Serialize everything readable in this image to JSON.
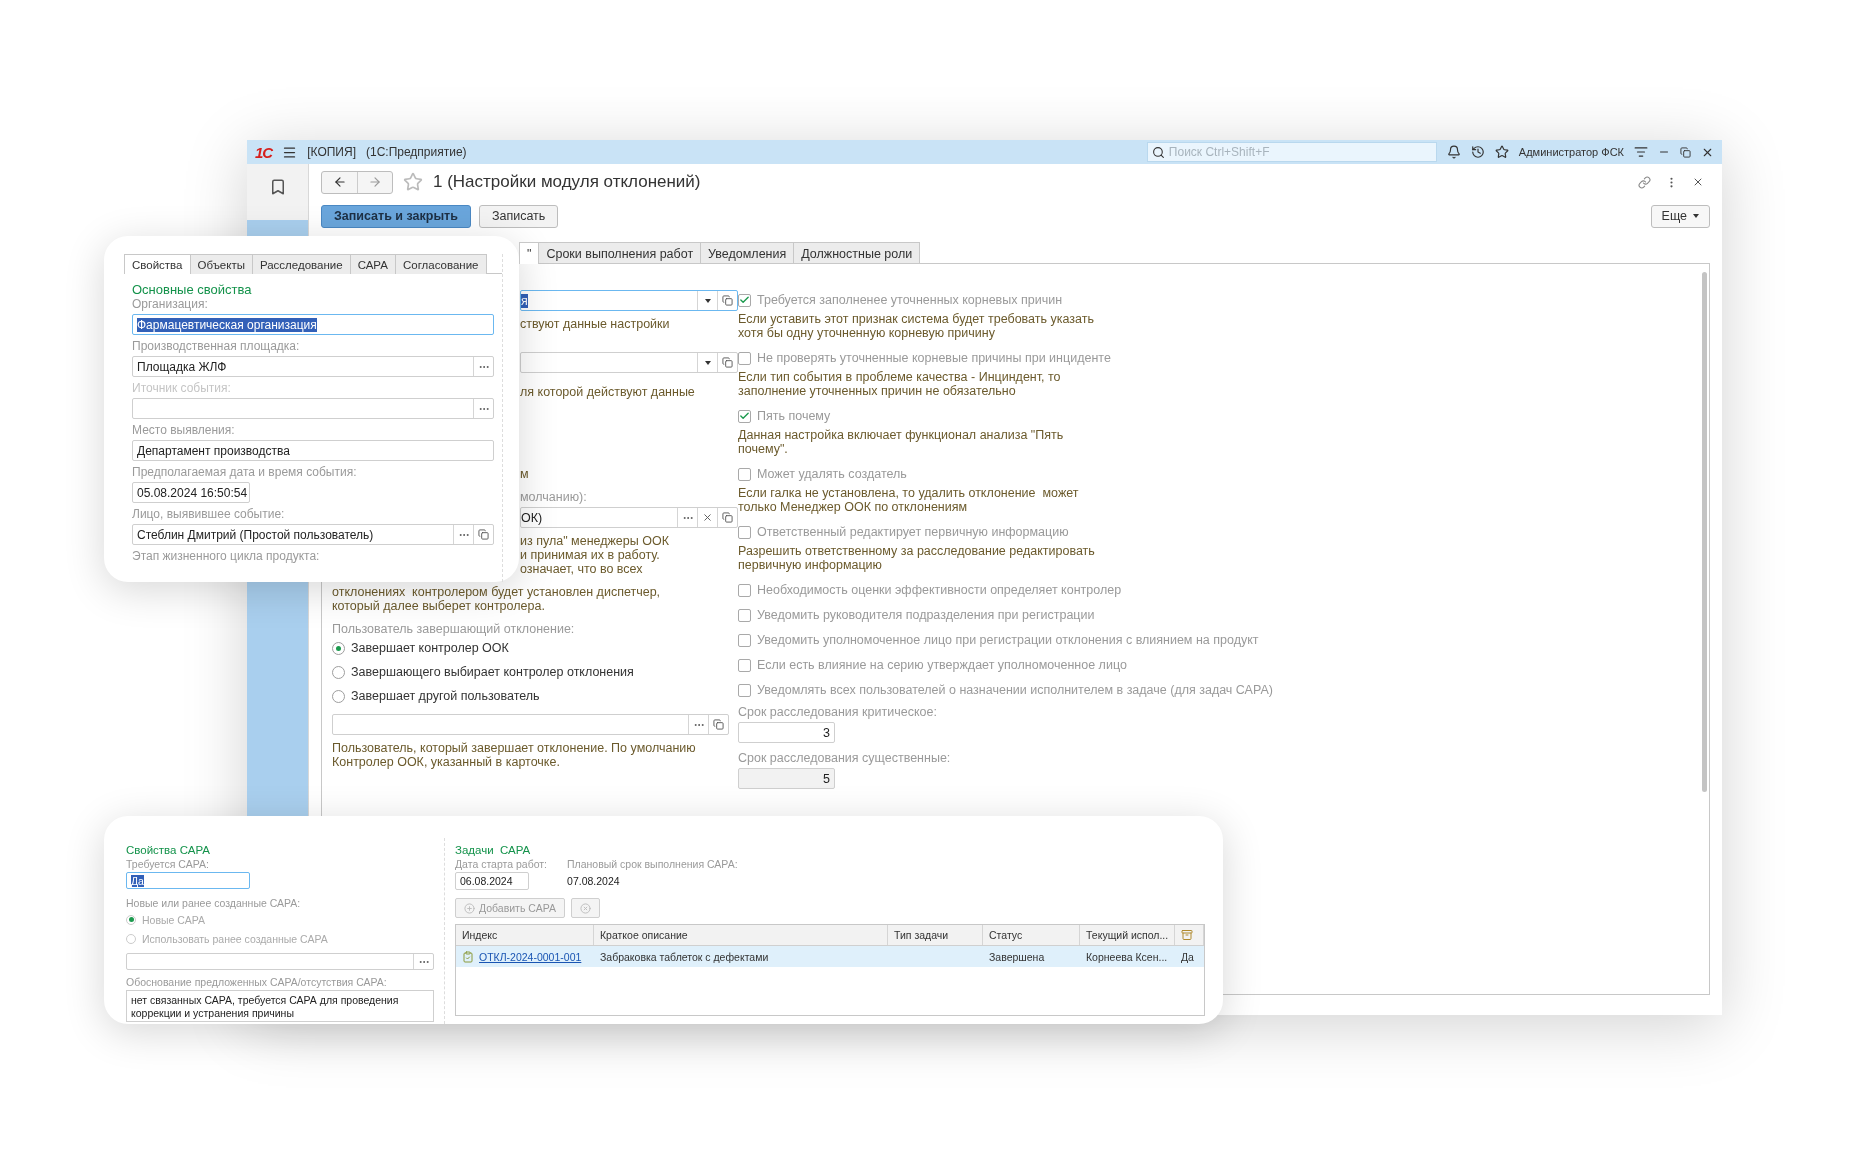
{
  "titlebar": {
    "logo": "1С",
    "title": "[КОПИЯ]",
    "app": "(1С:Предприятие)",
    "search_placeholder": "Поиск Ctrl+Shift+F",
    "user": "Администратор ФСК"
  },
  "form": {
    "title": "1 (Настройки модуля отклонений)",
    "buttons": [
      {
        "label": "Записать и закрыть",
        "kind": "primary"
      },
      {
        "label": "Записать",
        "kind": "default"
      }
    ],
    "more": "Еще"
  },
  "tabs": [
    {
      "label": "\"",
      "selected": true
    },
    {
      "label": "Сроки выполнения работ",
      "selected": false
    },
    {
      "label": "Уведомления",
      "selected": false
    },
    {
      "label": "Должностные роли",
      "selected": false
    }
  ],
  "settings_left": {
    "field_1": "я",
    "hint_1": "ствуют данные настройки",
    "hint_2": "ля которой действуют данные",
    "fragment": "м",
    "label_3": "молчанию):",
    "field_3": "ОК)",
    "hint_3_lines": [
      "из пула\" менеджеры ООК",
      "и принимая их в работу.",
      "означает, что во всех"
    ],
    "hint_4": "отклонениях  контролером будет установлен диспетчер, который далее выберет контролера.",
    "finisher": {
      "label": "Пользователь завершающий отклонение:",
      "options": [
        {
          "label": "Завершает контролер ООК",
          "selected": true
        },
        {
          "label": "Завершающего выбирает контролер отклонения",
          "selected": false
        },
        {
          "label": "Завершает другой пользователь",
          "selected": false
        }
      ]
    },
    "finisher_hint": "Пользователь, который завершает отклонение. По умолчанию Контролер ООК, указанный в карточке."
  },
  "settings_right": {
    "options": [
      {
        "label": "Требуется заполненее уточненных корневых причин",
        "checked": true,
        "note": "Если уставить этот признак система будет требовать указать хотя бы одну уточненную корневую причину"
      },
      {
        "label": "Не проверять уточненные корневые причины при инциденте",
        "checked": false,
        "note": "Если тип события в проблеме качества - Инциндент, то заполнение уточненных причин не обязательно"
      },
      {
        "label": "Пять почему",
        "checked": true,
        "note": "Данная настройка включает функционал анализа \"Пять почему\"."
      },
      {
        "label": "Может удалять создатель",
        "checked": false,
        "note": "Если галка не установлена, то удалить отклонение  может только Менеджер ООК по отклонениям"
      },
      {
        "label": "Ответственный редактирует первичную информацию",
        "checked": false,
        "note": "Разрешить ответственному за расследование редактировать первичную информацию"
      },
      {
        "label": "Необходимость оценки эффективности определяет контролер",
        "checked": false
      },
      {
        "label": "Уведомить руководителя подразделения при регистрации",
        "checked": false
      },
      {
        "label": "Уведомить уполномоченное лицо при регистрации отклонения с влиянием на продукт",
        "checked": false
      },
      {
        "label": "Если есть влияние на серию утверждает уполномоченное лицо",
        "checked": false
      },
      {
        "label": "Уведомлять всех пользователей о назначении исполнителем в задаче (для задач САРА)",
        "checked": false
      }
    ],
    "deadlines": [
      {
        "label": "Срок расследования критическое:",
        "value": "3",
        "disabled": false
      },
      {
        "label": "Срок расследования существенные:",
        "value": "5",
        "disabled": true
      }
    ]
  },
  "properties_panel": {
    "tabs": [
      {
        "label": "Свойства",
        "selected": true
      },
      {
        "label": "Объекты",
        "selected": false
      },
      {
        "label": "Расследование",
        "selected": false
      },
      {
        "label": "САРА",
        "selected": false
      },
      {
        "label": "Согласование",
        "selected": false
      }
    ],
    "heading": "Основные свойства",
    "fields": [
      {
        "label": "Организация:",
        "value": "Фармацевтическая организация",
        "kind": "focused",
        "disabled": false
      },
      {
        "label": "Производственная площадка:",
        "value": "Площадка ЖЛФ",
        "kind": "choice",
        "disabled": false
      },
      {
        "label": "Иточник события:",
        "kind": "choice",
        "disabled": true
      },
      {
        "label": "Место выявления:",
        "value": "Департамент производства",
        "kind": "text",
        "disabled": false
      },
      {
        "label": "Предполагаемая дата и время события:",
        "value": "05.08.2024 16:50:54",
        "kind": "date",
        "disabled": false
      },
      {
        "label": "Лицо, выявившее событие:",
        "value": "Стеблин Дмитрий (Простой пользователь)",
        "kind": "reference",
        "disabled": false
      },
      {
        "label": "Этап жизненного цикла продукта:",
        "kind": "cut",
        "disabled": false
      }
    ]
  },
  "capa_panel": {
    "heading": "Свойства САРА",
    "required_label": "Требуется САРА:",
    "required_value": "Да",
    "mode_label": "Новые или ранее созданные САРА:",
    "modes": [
      {
        "label": "Новые САРА",
        "selected": true
      },
      {
        "label": "Использовать ранее созданные САРА",
        "selected": false
      }
    ],
    "reason_label": "Обоснование предложенных САРА/отсутствия САРА:",
    "reason": "нет связанных САРА, требуется САРА для проведения коррекции и устранения причины",
    "tasks_heading": "Задачи  САРА",
    "start_label": "Дата старта работ:",
    "start_value": "06.08.2024",
    "plan_label": "Плановый срок выполнения САРА:",
    "plan_value": "07.08.2024",
    "add_button": "Добавить САРА",
    "table": {
      "columns": [
        "Индекс",
        "Краткое описание",
        "Тип задачи",
        "Статус",
        "Текущий испол..."
      ],
      "rows": [
        {
          "cells": [
            "ОТКЛ-2024-0001-001",
            "Забраковка таблеток с дефектами",
            "",
            "Завершена",
            "Корнеева Ксен...",
            "Да"
          ],
          "selected": true
        }
      ]
    }
  }
}
